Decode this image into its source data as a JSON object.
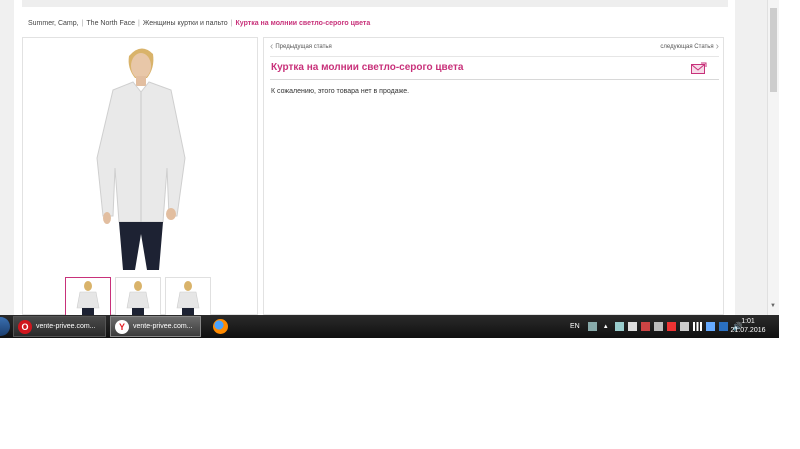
{
  "breadcrumb": {
    "items": [
      "Summer, Camp,",
      "The North Face",
      "Женщины куртки и пальто"
    ],
    "current": "Куртка на молнии светло-серого цвета"
  },
  "product": {
    "nav_prev": "Предыдущая статья",
    "nav_next": "следующая Статья",
    "title": "Куртка на молнии светло-серого цвета",
    "status": "К сожалению, этого товара нет в продаже."
  },
  "icons": {
    "mail": "envelope-share-icon",
    "prev": "chevron-left-icon",
    "next": "chevron-right-icon"
  },
  "colors": {
    "accent": "#c8317a",
    "taskbar": "#1a1a1a"
  },
  "taskbar": {
    "items": [
      {
        "label": "vente-privee.com...",
        "icon": "opera-icon"
      },
      {
        "label": "vente-privee.com...",
        "icon": "yandex-browser-icon"
      },
      {
        "label": "",
        "icon": "firefox-icon"
      }
    ],
    "language": "EN",
    "time": "1:01",
    "date": "21.07.2016"
  }
}
